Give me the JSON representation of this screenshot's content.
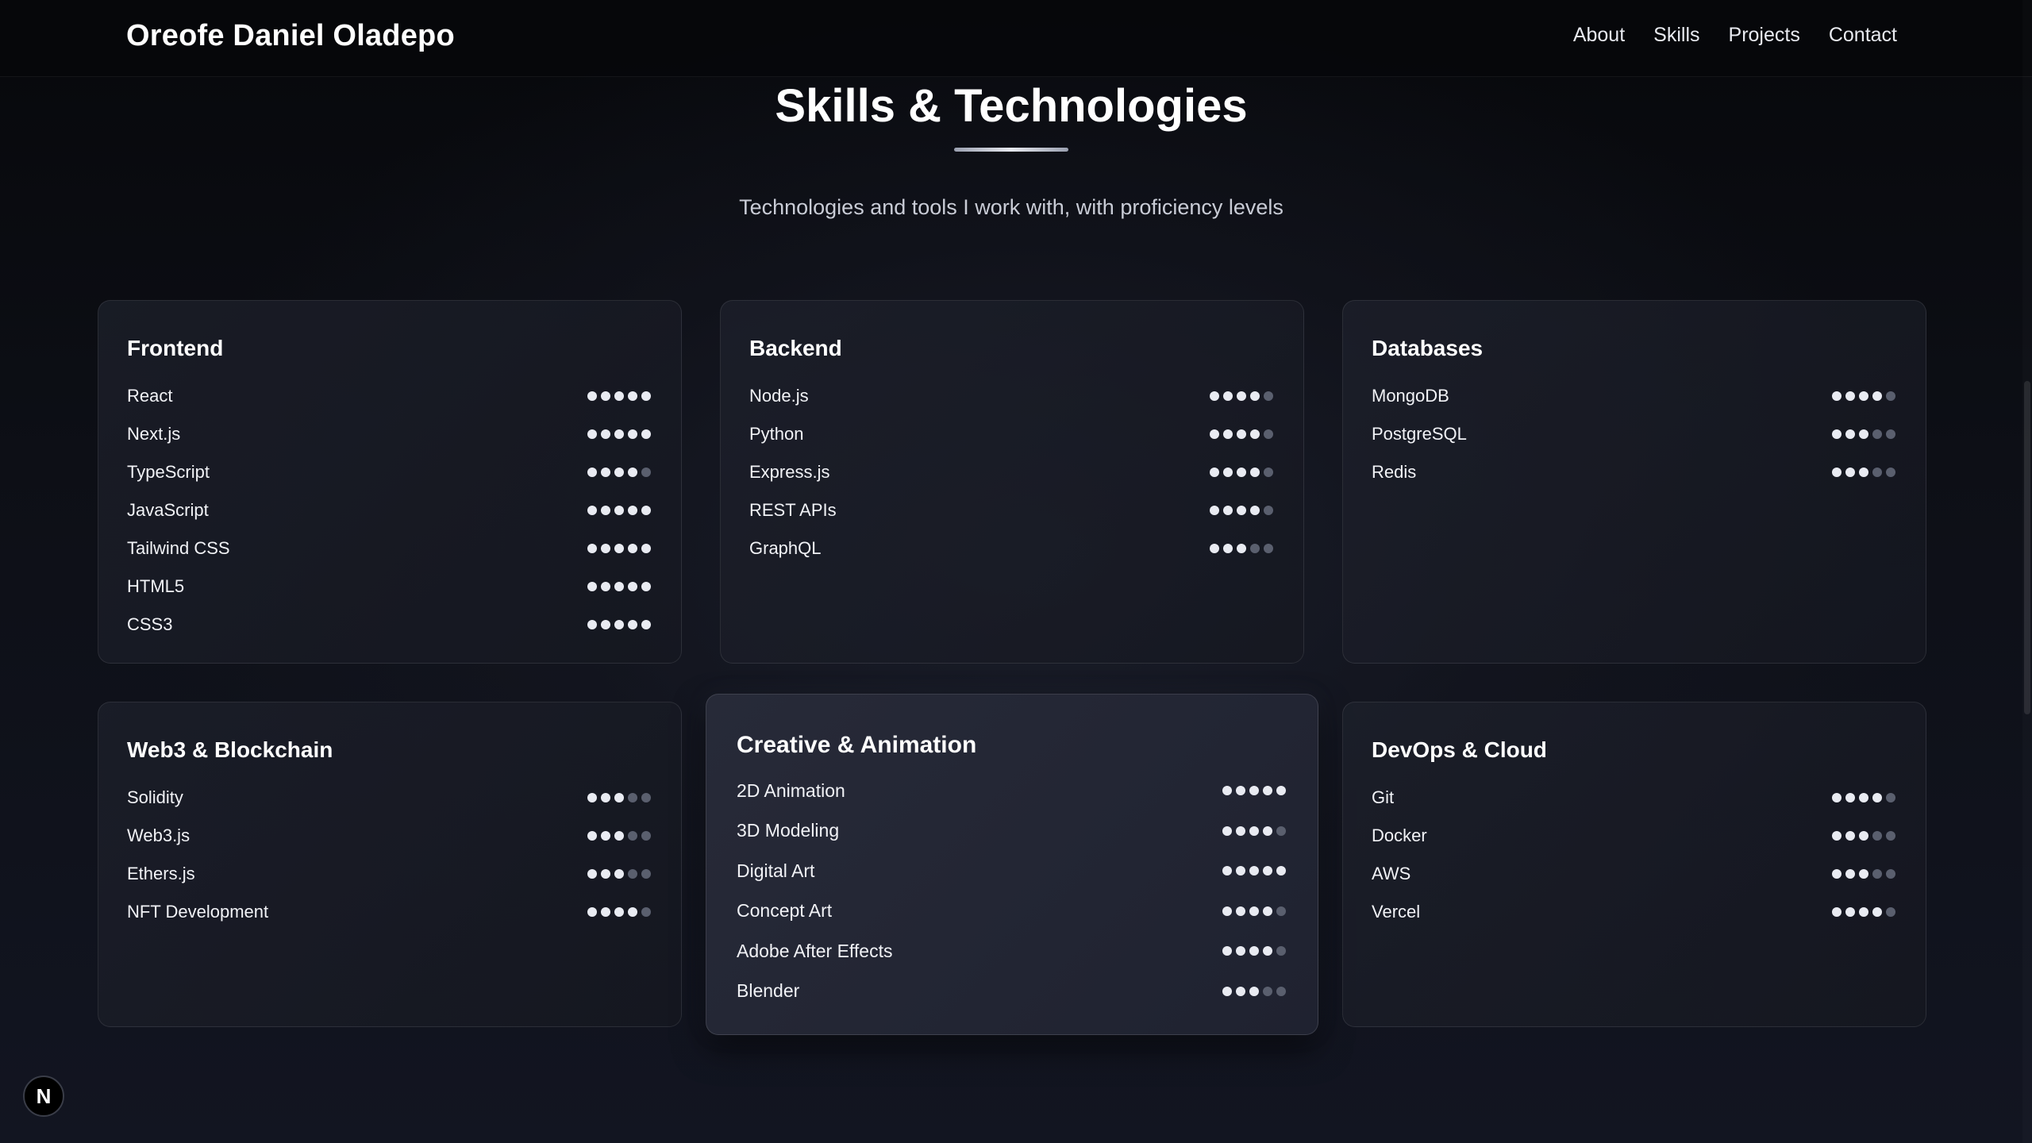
{
  "header": {
    "brand": "Oreofe Daniel Oladepo",
    "nav": [
      {
        "label": "About"
      },
      {
        "label": "Skills"
      },
      {
        "label": "Projects"
      },
      {
        "label": "Contact"
      }
    ]
  },
  "section": {
    "title": "Skills & Technologies",
    "subtitle": "Technologies and tools I work with, with proficiency levels"
  },
  "categories": [
    {
      "title": "Frontend",
      "skills": [
        {
          "name": "React",
          "level": 5
        },
        {
          "name": "Next.js",
          "level": 5
        },
        {
          "name": "TypeScript",
          "level": 4
        },
        {
          "name": "JavaScript",
          "level": 5
        },
        {
          "name": "Tailwind CSS",
          "level": 5
        },
        {
          "name": "HTML5",
          "level": 5
        },
        {
          "name": "CSS3",
          "level": 5
        }
      ]
    },
    {
      "title": "Backend",
      "skills": [
        {
          "name": "Node.js",
          "level": 4
        },
        {
          "name": "Python",
          "level": 4
        },
        {
          "name": "Express.js",
          "level": 4
        },
        {
          "name": "REST APIs",
          "level": 4
        },
        {
          "name": "GraphQL",
          "level": 3
        }
      ]
    },
    {
      "title": "Databases",
      "skills": [
        {
          "name": "MongoDB",
          "level": 4
        },
        {
          "name": "PostgreSQL",
          "level": 3
        },
        {
          "name": "Redis",
          "level": 3
        }
      ]
    },
    {
      "title": "Web3 & Blockchain",
      "skills": [
        {
          "name": "Solidity",
          "level": 3
        },
        {
          "name": "Web3.js",
          "level": 3
        },
        {
          "name": "Ethers.js",
          "level": 3
        },
        {
          "name": "NFT Development",
          "level": 4
        }
      ]
    },
    {
      "title": "Creative & Animation",
      "skills": [
        {
          "name": "2D Animation",
          "level": 5
        },
        {
          "name": "3D Modeling",
          "level": 4
        },
        {
          "name": "Digital Art",
          "level": 5
        },
        {
          "name": "Concept Art",
          "level": 4
        },
        {
          "name": "Adobe After Effects",
          "level": 4
        },
        {
          "name": "Blender",
          "level": 3
        }
      ]
    },
    {
      "title": "DevOps & Cloud",
      "skills": [
        {
          "name": "Git",
          "level": 4
        },
        {
          "name": "Docker",
          "level": 3
        },
        {
          "name": "AWS",
          "level": 3
        },
        {
          "name": "Vercel",
          "level": 4
        }
      ]
    }
  ],
  "max_level": 5,
  "badge": {
    "letter": "N"
  },
  "colors": {
    "background": "#0a0b0f",
    "card": "#1c1f2a",
    "dot_on": "#e9ebf2",
    "dot_off": "#5a5f6e"
  }
}
